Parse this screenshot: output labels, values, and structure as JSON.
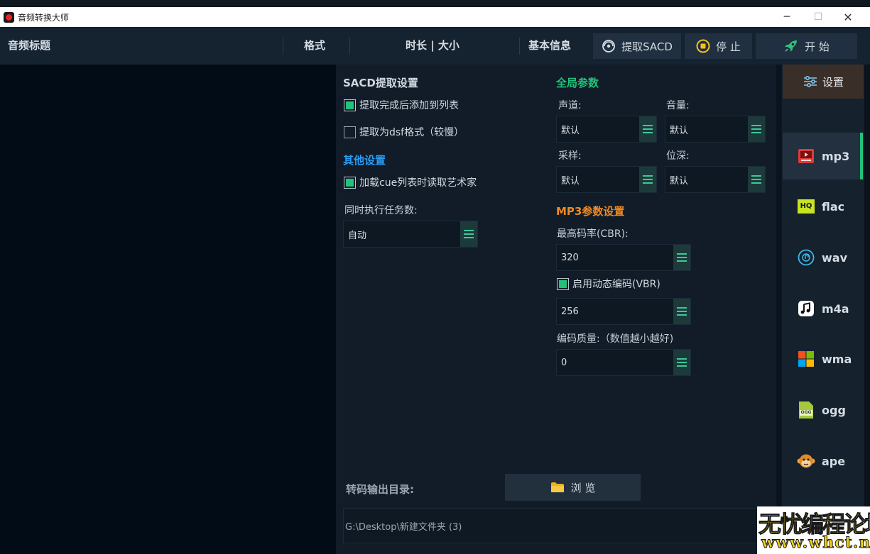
{
  "window": {
    "title": "音频转换大师",
    "min_glyph": "─",
    "max_glyph": "☐",
    "close_glyph": "✕"
  },
  "header": {
    "col_title": "音频标题",
    "col_format": "格式",
    "col_duration_size": "时长 | 大小",
    "col_info": "基本信息",
    "btn_extract_sacd": "提取SACD",
    "btn_stop": "停 止",
    "btn_start": "开 始"
  },
  "sacd": {
    "title": "SACD提取设置",
    "add_to_list_label": "提取完成后添加到列表",
    "add_to_list_checked": true,
    "dsf_label": "提取为dsf格式（较慢）",
    "dsf_checked": false
  },
  "other": {
    "title": "其他设置",
    "cue_artist_label": "加载cue列表时读取艺术家",
    "cue_artist_checked": true,
    "tasks_label": "同时执行任务数:",
    "tasks_value": "自动"
  },
  "global": {
    "title": "全局参数",
    "channel_label": "声道:",
    "channel_value": "默认",
    "volume_label": "音量:",
    "volume_value": "默认",
    "sample_label": "采样:",
    "sample_value": "默认",
    "bitdepth_label": "位深:",
    "bitdepth_value": "默认"
  },
  "mp3": {
    "title": "MP3参数设置",
    "max_bitrate_label": "最高码率(CBR):",
    "max_bitrate_value": "320",
    "vbr_label": "启用动态编码(VBR)",
    "vbr_checked": true,
    "vbr_value": "256",
    "quality_label": "编码质量:（数值越小越好)",
    "quality_value": "0"
  },
  "output": {
    "label": "转码输出目录:",
    "browse_label": "浏 览",
    "path": "G:\\Desktop\\新建文件夹 (3)"
  },
  "sidebar": {
    "settings_label": "设置",
    "formats": [
      {
        "label": "mp3",
        "active": true
      },
      {
        "label": "flac",
        "active": false
      },
      {
        "label": "wav",
        "active": false
      },
      {
        "label": "m4a",
        "active": false
      },
      {
        "label": "wma",
        "active": false
      },
      {
        "label": "ogg",
        "active": false
      },
      {
        "label": "ape",
        "active": false
      }
    ],
    "flac_icon_text": "HQ",
    "ogg_icon_text": "OGG"
  },
  "watermark": {
    "line1": "无忧编程论坛",
    "line2": "www.whct.net"
  },
  "colors": {
    "accent_green": "#23c27a",
    "title_sacd": "#d0d7de",
    "title_other": "#2a9df4",
    "title_global": "#23c27a",
    "title_mp3": "#f08a24"
  }
}
